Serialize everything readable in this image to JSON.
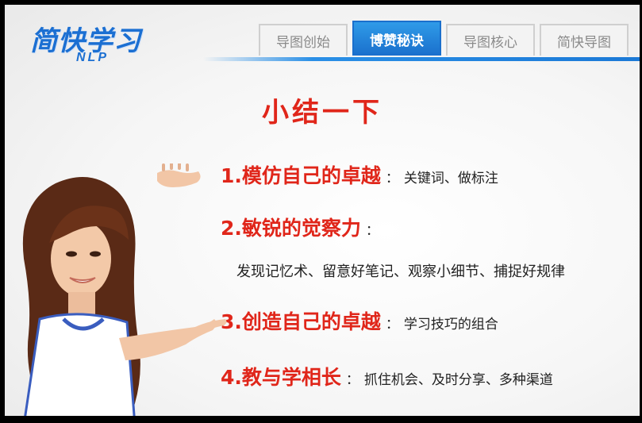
{
  "logo": {
    "main": "简快学习",
    "sub": "NLP"
  },
  "tabs": [
    {
      "label": "导图创始",
      "active": false
    },
    {
      "label": "博赞秘诀",
      "active": true
    },
    {
      "label": "导图核心",
      "active": false
    },
    {
      "label": "简快导图",
      "active": false
    }
  ],
  "title": "小结一下",
  "items": [
    {
      "head": "1.模仿自己的卓越",
      "note": "关键词、做标注"
    },
    {
      "head": "2.敏锐的觉察力",
      "note": "",
      "detail": "发现记忆术、留意好笔记、观察小细节、捕捉好规律"
    },
    {
      "head": "3.创造自己的卓越",
      "note": "学习技巧的组合"
    },
    {
      "head": "4.教与学相长",
      "note": "抓住机会、及时分享、多种渠道"
    }
  ],
  "colors": {
    "accent_red": "#e0261a",
    "brand_blue": "#1b6fd2",
    "tab_active": "#1a6fcc"
  },
  "illustration": "woman-pointing-illustration"
}
